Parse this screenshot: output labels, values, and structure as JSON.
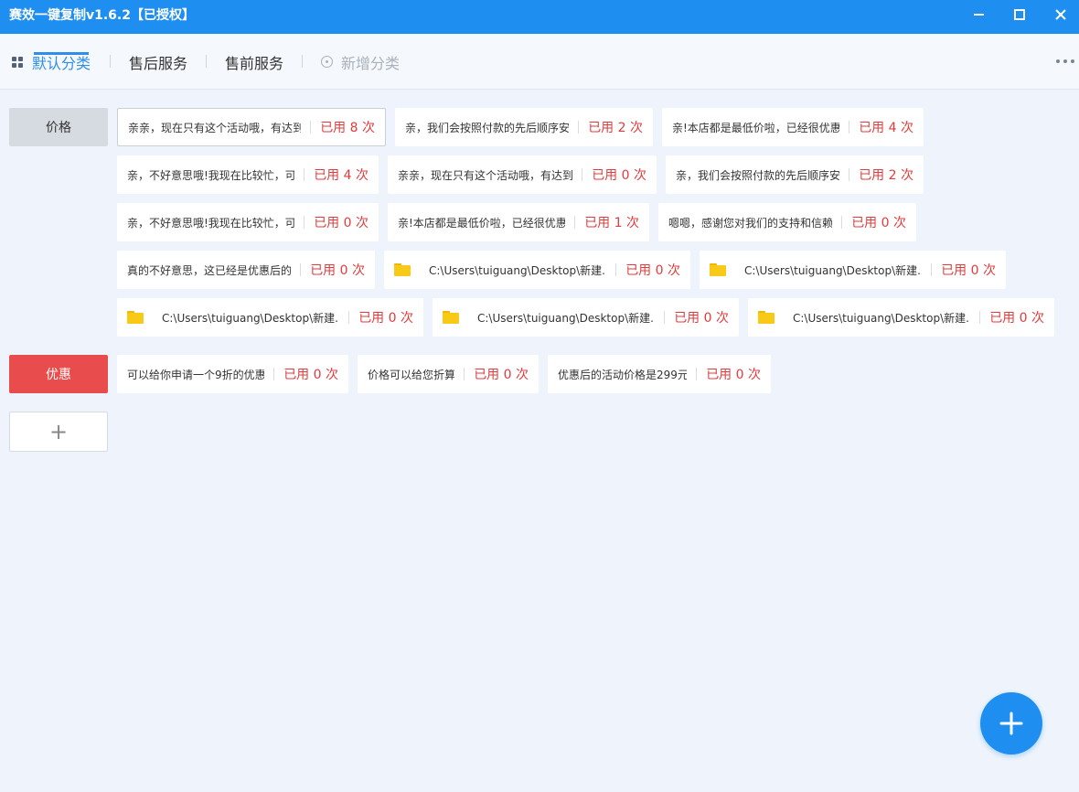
{
  "window": {
    "title": "赛效一键复制v1.6.2【已授权】"
  },
  "tabs": [
    {
      "label": "默认分类"
    },
    {
      "label": "售后服务"
    },
    {
      "label": "售前服务"
    },
    {
      "label": "新增分类"
    }
  ],
  "categories": {
    "price": "价格",
    "discount": "优惠",
    "add": "+"
  },
  "price_items": [
    {
      "text": "亲亲，现在只有这个活动哦，有达到",
      "count": "已用 8 次"
    },
    {
      "text": "亲，我们会按照付款的先后顺序安",
      "count": "已用 2 次"
    },
    {
      "text": "亲!本店都是最低价啦，已经很优惠",
      "count": "已用 4 次"
    },
    {
      "text": "亲，不好意思哦!我现在比较忙，可",
      "count": "已用 4 次"
    },
    {
      "text": "亲亲，现在只有这个活动哦，有达到",
      "count": "已用 0 次"
    },
    {
      "text": "亲，我们会按照付款的先后顺序安",
      "count": "已用 2 次"
    },
    {
      "text": "亲，不好意思哦!我现在比较忙，可",
      "count": "已用 0 次"
    },
    {
      "text": "亲!本店都是最低价啦，已经很优惠",
      "count": "已用 1 次"
    },
    {
      "text": "嗯嗯，感谢您对我们的支持和信赖",
      "count": "已用 0 次"
    },
    {
      "text": "真的不好意思，这已经是优惠后的",
      "count": "已用 0 次"
    },
    {
      "text": "C:\\Users\\tuiguang\\Desktop\\新建...",
      "count": "已用 0 次"
    },
    {
      "text": "C:\\Users\\tuiguang\\Desktop\\新建...",
      "count": "已用 0 次"
    },
    {
      "text": "C:\\Users\\tuiguang\\Desktop\\新建...",
      "count": "已用 0 次"
    },
    {
      "text": "C:\\Users\\tuiguang\\Desktop\\新建...",
      "count": "已用 0 次"
    },
    {
      "text": "C:\\Users\\tuiguang\\Desktop\\新建...",
      "count": "已用 0 次"
    }
  ],
  "discount_items": [
    {
      "text": "可以给你申请一个9折的优惠",
      "count": "已用 0 次"
    },
    {
      "text": "价格可以给您折算",
      "count": "已用 0 次"
    },
    {
      "text": "优惠后的活动价格是299元",
      "count": "已用 0 次"
    }
  ],
  "colors": {
    "accent": "#1e8ff0",
    "count_red": "#e33b3b",
    "discount_category": "#e94c4c",
    "folder": "#f8c916"
  }
}
